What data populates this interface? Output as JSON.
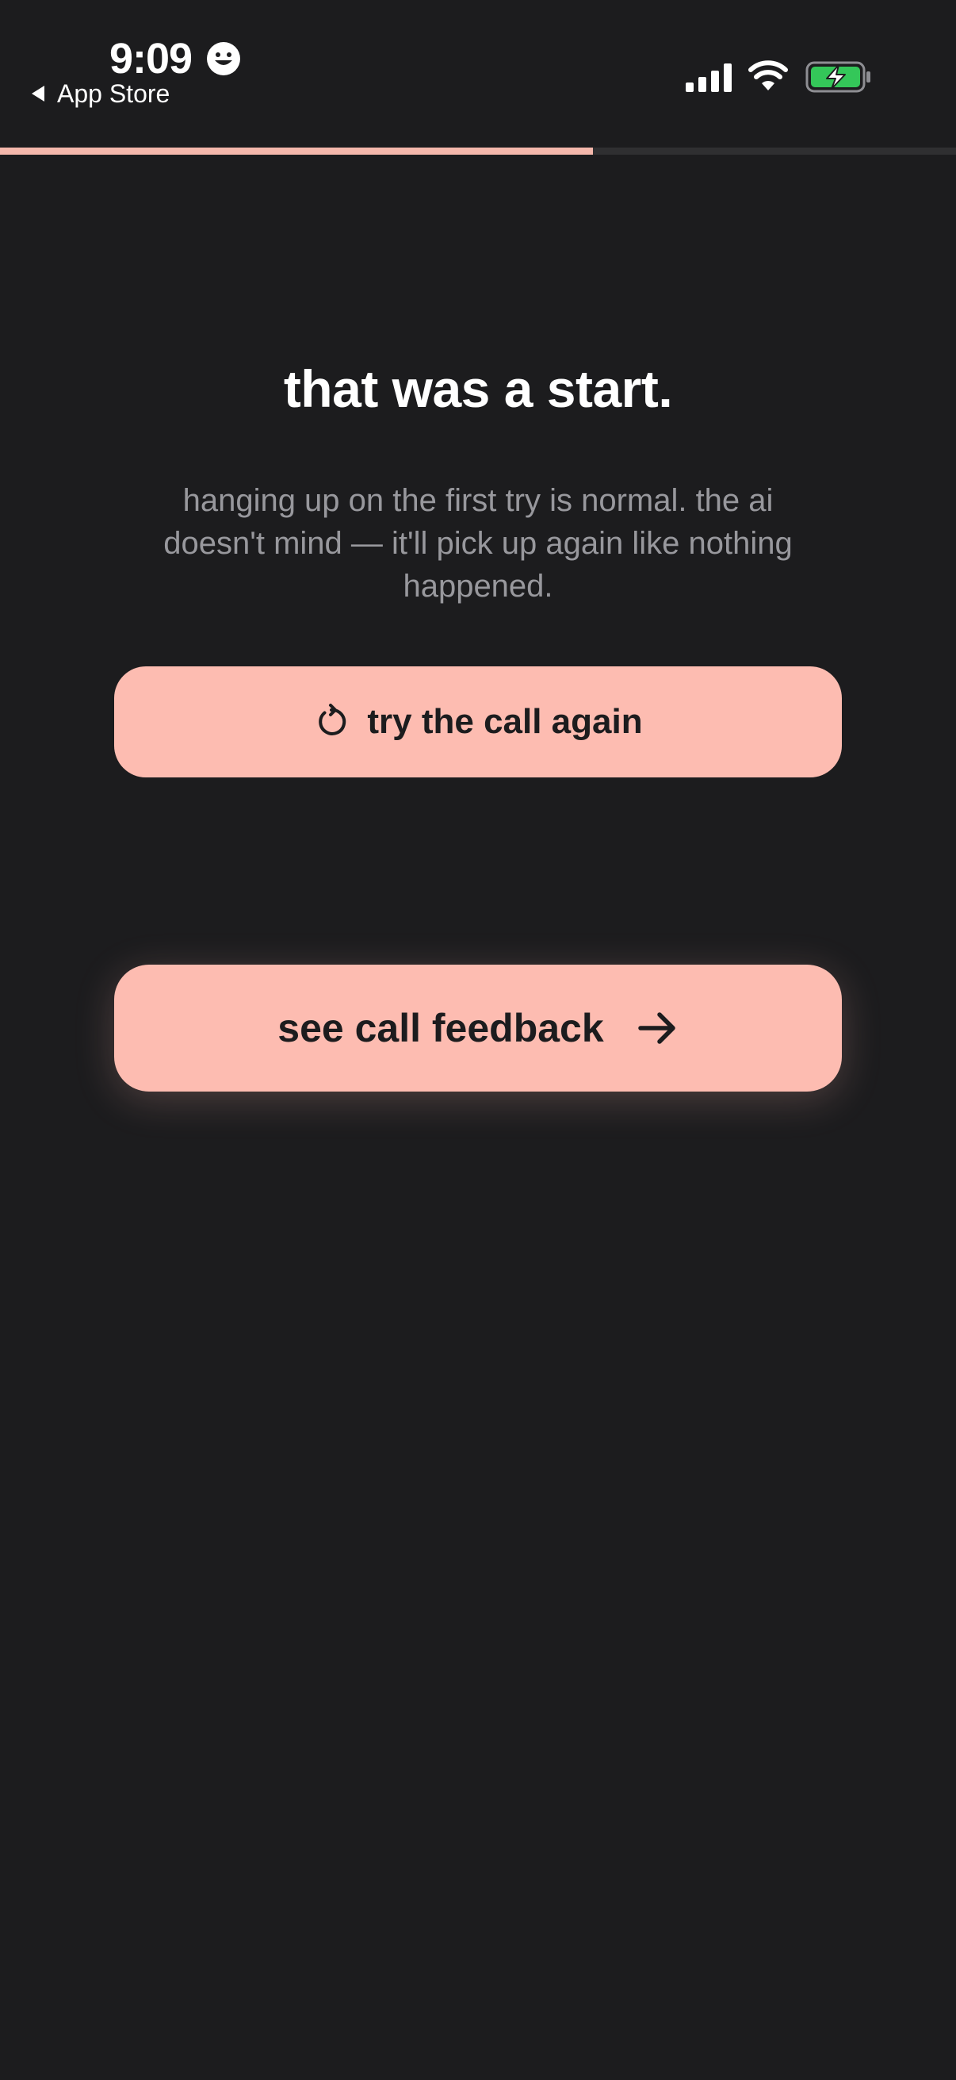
{
  "status_bar": {
    "time": "9:09",
    "back_label": "App Store",
    "icons": [
      "smiley-icon",
      "back-triangle-icon",
      "cellular-signal-icon",
      "wifi-icon",
      "battery-charging-icon"
    ]
  },
  "progress": {
    "fraction": 0.62
  },
  "main": {
    "title": "that was a start.",
    "subtitle": "hanging up on the first try is normal. the ai doesn't mind — it'll pick up again like nothing happened.",
    "retry_button": {
      "label": "try the call again",
      "icon": "retry-icon"
    },
    "feedback_button": {
      "label": "see call feedback",
      "icon": "arrow-right-icon"
    }
  },
  "colors": {
    "background": "#1c1c1e",
    "accent": "#fdbcb1",
    "progress_fill": "#f4b8ac",
    "subtitle": "#98989d",
    "battery_green": "#34c759"
  }
}
